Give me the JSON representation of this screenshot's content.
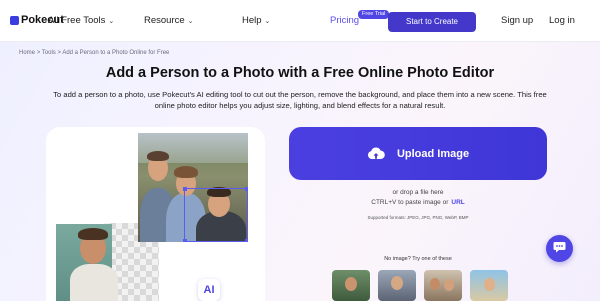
{
  "nav": {
    "logo_text": "Pokecut",
    "items": [
      {
        "label": "All Free Tools"
      },
      {
        "label": "Resource"
      },
      {
        "label": "Help"
      }
    ],
    "pricing_label": "Pricing",
    "free_trial_badge": "Free Trial",
    "start_button_label": "Start to Create",
    "signup_label": "Sign up",
    "login_label": "Log in"
  },
  "breadcrumb": {
    "home": "Home",
    "tools": "Tools",
    "current": "Add a Person to a Photo Online for Free",
    "separator": ">"
  },
  "hero": {
    "title": "Add a Person to a Photo with a Free Online Photo Editor",
    "description": "To add a person to a photo, use Pokecut's AI editing tool to cut out the person, remove the background, and place them into a new scene. This free online photo editor helps you adjust size, lighting, and blend effects for a natural result."
  },
  "upload": {
    "button_label": "Upload Image",
    "drop_text": "or drop a file here",
    "paste_text": "CTRL+V to paste image or",
    "url_label": "URL",
    "formats_text": "Supported formats: JPEG, JPG, PNG, WebP, BMP"
  },
  "samples": {
    "title": "No image? Try one of these"
  },
  "demo": {
    "ai_badge": "AI"
  },
  "colors": {
    "accent": "#4f46e5",
    "upload_bg": "#4338ca"
  },
  "icons": {
    "upload": "cloud-upload-icon",
    "chat": "chat-bubble-icon",
    "chevron": "chevron-down-icon"
  }
}
